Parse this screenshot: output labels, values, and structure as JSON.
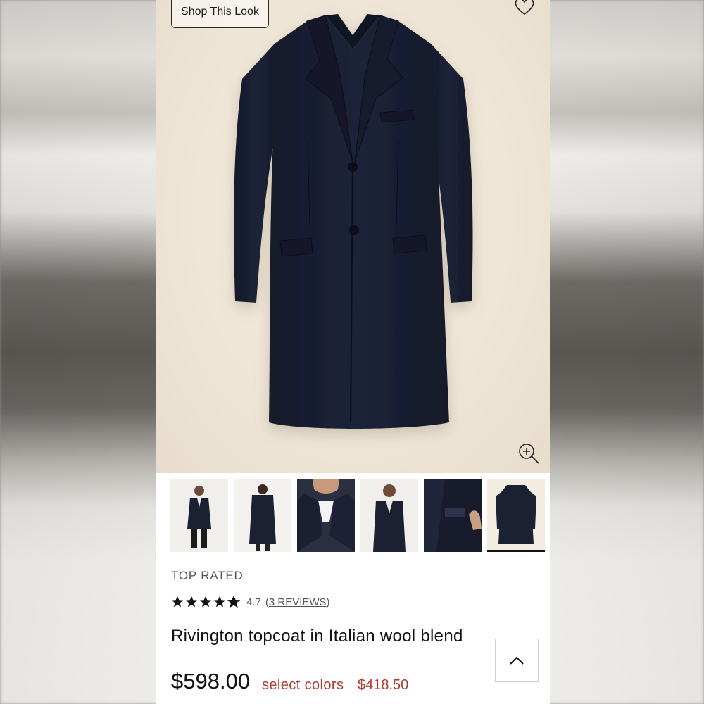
{
  "gallery": {
    "shop_look_label": "Shop This Look",
    "heart_icon": "heart-outline-icon",
    "zoom_icon": "zoom-in-icon",
    "thumbnails": [
      {
        "name": "model-full-front"
      },
      {
        "name": "model-back"
      },
      {
        "name": "model-collar-closeup"
      },
      {
        "name": "model-front-close"
      },
      {
        "name": "interior-label-detail"
      },
      {
        "name": "flat-lay-coat",
        "selected": true
      }
    ]
  },
  "product": {
    "badge": "TOP RATED",
    "rating": {
      "stars": 4.7,
      "value": "4.7",
      "open_paren": "(",
      "reviews": "3 REVIEWS",
      "close_paren": ")"
    },
    "title": "Rivington topcoat in Italian wool blend",
    "price": "$598.00",
    "sale_label": "select colors",
    "sale_price": "$418.50"
  },
  "colors": {
    "sale": "#b03a2e",
    "coat_navy": "#1b2033",
    "hero_bg": "#efe6d7"
  },
  "controls": {
    "scroll_top_icon": "chevron-up-icon"
  }
}
